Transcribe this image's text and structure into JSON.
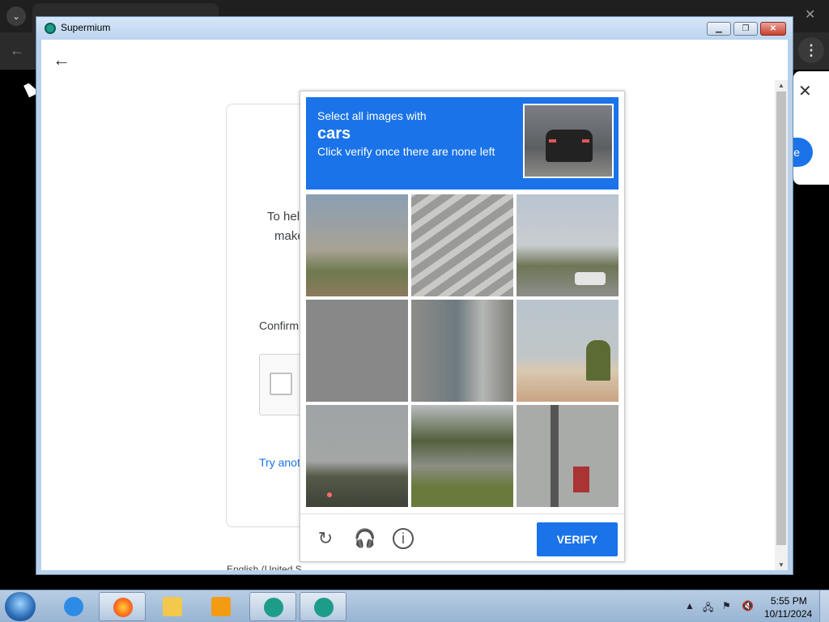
{
  "window": {
    "title": "Supermium"
  },
  "card": {
    "text1": "To hel",
    "text2": "make",
    "confirm": "Confirm",
    "try_another": "Try anot",
    "language": "English (United S"
  },
  "captcha": {
    "line1": "Select all images with",
    "target": "cars",
    "line3": "Click verify once there are none left",
    "verify_label": "VERIFY",
    "tiles": [
      "tile-1",
      "tile-2",
      "tile-3",
      "tile-4",
      "tile-5",
      "tile-6",
      "tile-7",
      "tile-8",
      "tile-9"
    ]
  },
  "taskbar": {
    "time": "5:55 PM",
    "date": "10/11/2024",
    "items": [
      "internet-explorer",
      "firefox",
      "file-explorer",
      "media-player",
      "supermium-profile",
      "supermium"
    ]
  },
  "colors": {
    "accent": "#1a73e8",
    "captcha_header": "#1a73e8"
  }
}
